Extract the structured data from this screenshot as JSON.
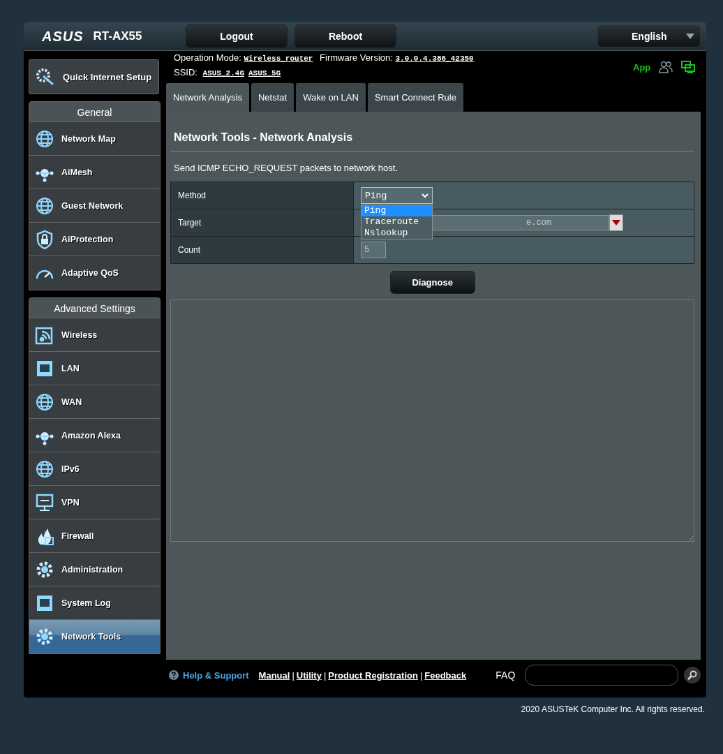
{
  "header": {
    "logo": "ASUS",
    "model": "RT-AX55",
    "buttons": [
      "Logout",
      "Reboot"
    ],
    "language": "English"
  },
  "status": {
    "mode_label": "Operation Mode:",
    "mode": "Wireless_router",
    "firmware_label": "Firmware Version:",
    "firmware": "3.0.0.4.386_42350",
    "ssid_label": "SSID:",
    "ssids": [
      "ASUS_2.4G",
      "ASUS_5G"
    ],
    "app": "App"
  },
  "quick_setup": "Quick Internet Setup",
  "sidebar": {
    "sections": [
      {
        "title": "General",
        "items": [
          {
            "label": "Network Map",
            "selected": false
          },
          {
            "label": "AiMesh",
            "selected": false
          },
          {
            "label": "Guest Network",
            "selected": false
          },
          {
            "label": "AiProtection",
            "selected": false
          },
          {
            "label": "Adaptive QoS",
            "selected": false
          }
        ]
      },
      {
        "title": "Advanced Settings",
        "items": [
          {
            "label": "Wireless",
            "selected": false
          },
          {
            "label": "LAN",
            "selected": false
          },
          {
            "label": "WAN",
            "selected": false
          },
          {
            "label": "Amazon Alexa",
            "selected": false
          },
          {
            "label": "IPv6",
            "selected": false
          },
          {
            "label": "VPN",
            "selected": false
          },
          {
            "label": "Firewall",
            "selected": false
          },
          {
            "label": "Administration",
            "selected": false
          },
          {
            "label": "System Log",
            "selected": false
          },
          {
            "label": "Network Tools",
            "selected": true
          }
        ]
      }
    ]
  },
  "tabs": [
    {
      "label": "Network Analysis",
      "selected": true
    },
    {
      "label": "Netstat",
      "selected": false
    },
    {
      "label": "Wake on LAN",
      "selected": false
    },
    {
      "label": "Smart Connect Rule",
      "selected": false
    }
  ],
  "page": {
    "title": "Network Tools - Network Analysis",
    "description": "Send ICMP ECHO_REQUEST packets to network host."
  },
  "form": {
    "method_label": "Method",
    "method": "Ping",
    "method_expanded": true,
    "options": [
      {
        "label": "Ping",
        "selected": true
      },
      {
        "label": "Traceroute",
        "selected": false
      },
      {
        "label": "Nslookup",
        "selected": false
      }
    ],
    "target_label": "Target",
    "target_placeholder": "e.com",
    "count_label": "Count",
    "count_placeholder": "5"
  },
  "diagnose": "Diagnose",
  "footer": {
    "help": "Help & Support",
    "links": [
      "Manual",
      "Utility",
      "Product Registration",
      "Feedback"
    ],
    "separator": "|",
    "faq": "FAQ"
  },
  "copyright": "2020 ASUSTeK Computer Inc. All rights reserved."
}
